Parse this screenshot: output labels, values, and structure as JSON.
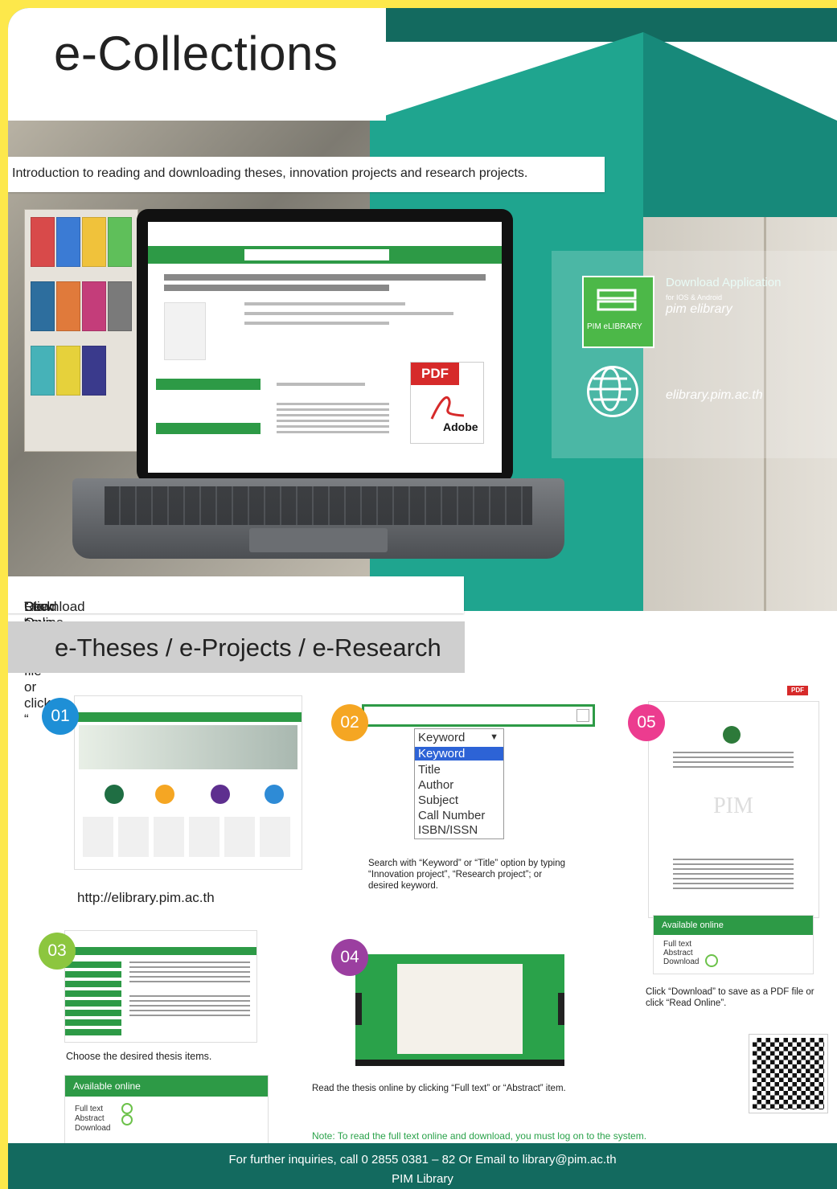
{
  "header": {
    "title": "e-Collections"
  },
  "intro_text": "Introduction to reading and downloading theses, innovation projects and research projects.",
  "app_promo": {
    "download_label": "Download Application",
    "platforms": "for IOS & Android",
    "app_name": "pim elibrary",
    "app_icon_text": "PIM eLIBRARY",
    "website": "elibrary.pim.ac.th"
  },
  "pdf_badge": {
    "tag": "PDF",
    "label": "Adobe"
  },
  "click_instruction": {
    "prefix": "Click “",
    "download": "Download",
    "middle": "” to save as a PDF file or click “",
    "read_online": "Read Online",
    "suffix": "”."
  },
  "section_title": "e-Theses / e-Projects / e-Research",
  "steps": [
    {
      "number": "01",
      "color": "#1e8fd6",
      "caption": "http://elibrary.pim.ac.th"
    },
    {
      "number": "02",
      "color": "#f5a623",
      "caption": "Search with “Keyword” or “Title” option by typing “Innovation project”, “Research project”; or desired keyword."
    },
    {
      "number": "03",
      "color": "#8cc63f",
      "caption": "Choose the desired thesis items."
    },
    {
      "number": "04",
      "color": "#9b3fa0",
      "caption": "Read the thesis online by clicking “Full text” or “Abstract” item."
    },
    {
      "number": "05",
      "color": "#ec3c8f",
      "caption": "Click “Download” to save as a PDF file or click “Read Online”."
    }
  ],
  "search_dropdown": {
    "selected": "Keyword",
    "options": [
      "Keyword",
      "Title",
      "Author",
      "Subject",
      "Call Number",
      "ISBN/ISSN"
    ]
  },
  "available_online": {
    "heading": "Available online",
    "items": [
      "Full text",
      "Abstract",
      "Download"
    ]
  },
  "note": "Note: To read the full text online and download, you must log on to the system.",
  "footer": {
    "line1": "For further inquiries, call 0 2855 0381 – 82 Or Email to library@pim.ac.th",
    "line2": "PIM Library"
  },
  "colors": {
    "teal": "#1fa58f",
    "dark_teal": "#136a5f",
    "green": "#2aa24a",
    "yellow_border": "#fde84b"
  }
}
